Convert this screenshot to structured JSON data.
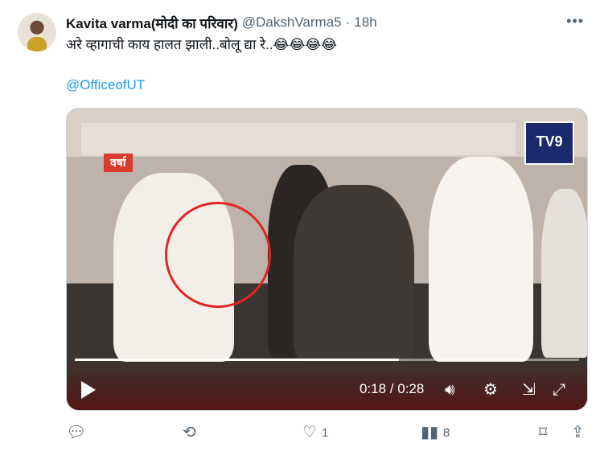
{
  "tweet": {
    "author_name": "Kavita varma(मोदी का परिवार)",
    "handle": "@DakshVarma5",
    "separator": "·",
    "time": "18h",
    "text": "अरे व्हागाची काय हालत झाली..बोलू द्या रे..😂😂😂😂",
    "mention": "@OfficeofUT"
  },
  "video": {
    "channel_logo": "TV9",
    "overlay_tag": "वर्षा",
    "current_time": "0:18",
    "duration": "0:28",
    "timecode": "0:18 / 0:28",
    "progress_fraction": 0.6428
  },
  "actions": {
    "reply_count": "",
    "repost_count": "",
    "like_count": "1",
    "views_count": "8"
  },
  "icons": {
    "more": "more-icon",
    "play": "play-icon",
    "volume": "volume-icon",
    "settings": "gear-icon",
    "popout": "popout-icon",
    "fullscreen": "fullscreen-icon",
    "reply": "reply-icon",
    "repost": "repost-icon",
    "like": "heart-icon",
    "views": "views-icon",
    "bookmark": "bookmark-icon",
    "share": "share-icon"
  },
  "colors": {
    "link": "#1d9bf0",
    "muted": "#536471",
    "highlight_circle": "#e32424"
  }
}
